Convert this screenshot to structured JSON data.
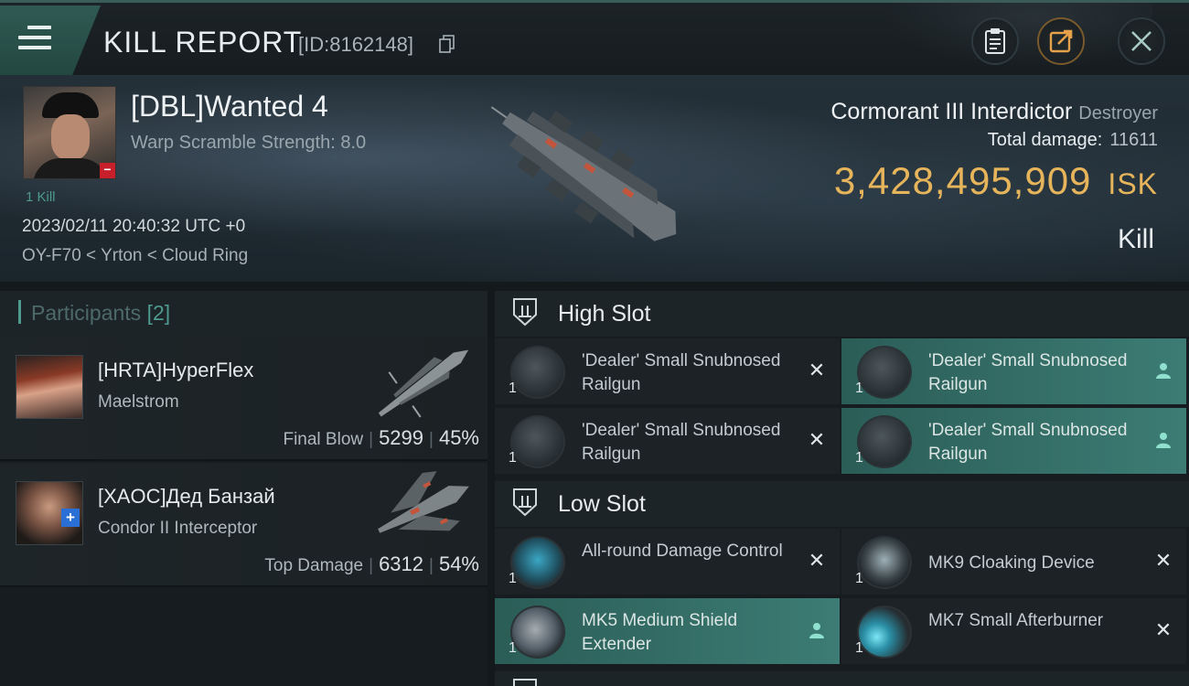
{
  "header": {
    "title": "KILL REPORT",
    "report_id": "[ID:8162148]"
  },
  "victim": {
    "name": "[DBL]Wanted 4",
    "warp_scramble": "Warp Scramble Strength: 8.0",
    "kill_count": "1 Kill",
    "datetime": "2023/02/11 20:40:32 UTC +0",
    "location": "OY-F70 < Yrton < Cloud Ring",
    "ship_name": "Cormorant III Interdictor",
    "ship_class": "Destroyer",
    "total_damage_label": "Total damage:",
    "total_damage_value": "11611",
    "isk_value": "3,428,495,909",
    "isk_unit": "ISK",
    "result": "Kill"
  },
  "participants": {
    "label": "Participants",
    "count": "[2]",
    "list": [
      {
        "name": "[HRTA]HyperFlex",
        "ship": "Maelstrom",
        "role": "Final Blow",
        "damage": "5299",
        "percent": "45%"
      },
      {
        "name": "[XAOC]Дед Банзай",
        "ship": "Condor II Interceptor",
        "role": "Top Damage",
        "damage": "6312",
        "percent": "54%"
      }
    ]
  },
  "slots": {
    "high": {
      "label": "High Slot",
      "modules": [
        {
          "name": "'Dealer' Small Snubnosed Railgun",
          "qty": "1",
          "state": "destroyed"
        },
        {
          "name": "'Dealer' Small Snubnosed Railgun",
          "qty": "1",
          "state": "dropped"
        },
        {
          "name": "'Dealer' Small Snubnosed Railgun",
          "qty": "1",
          "state": "destroyed"
        },
        {
          "name": "'Dealer' Small Snubnosed Railgun",
          "qty": "1",
          "state": "dropped"
        }
      ]
    },
    "low": {
      "label": "Low Slot",
      "modules": [
        {
          "name": "All-round Damage Control",
          "qty": "1",
          "state": "destroyed"
        },
        {
          "name": "MK9 Cloaking Device",
          "qty": "1",
          "state": "destroyed"
        },
        {
          "name": "MK5 Medium Shield Extender",
          "qty": "1",
          "state": "dropped"
        },
        {
          "name": "MK7 Small Afterburner",
          "qty": "1",
          "state": "destroyed"
        }
      ]
    }
  },
  "colors": {
    "accent_teal": "#4e9a8f",
    "isk_gold": "#e6b45a",
    "dropped_bg": "#3c7c74"
  },
  "icons": [
    "menu-icon",
    "copy-icon",
    "clipboard-icon",
    "share-icon",
    "close-icon",
    "slot-icon",
    "person-icon",
    "x-icon"
  ]
}
